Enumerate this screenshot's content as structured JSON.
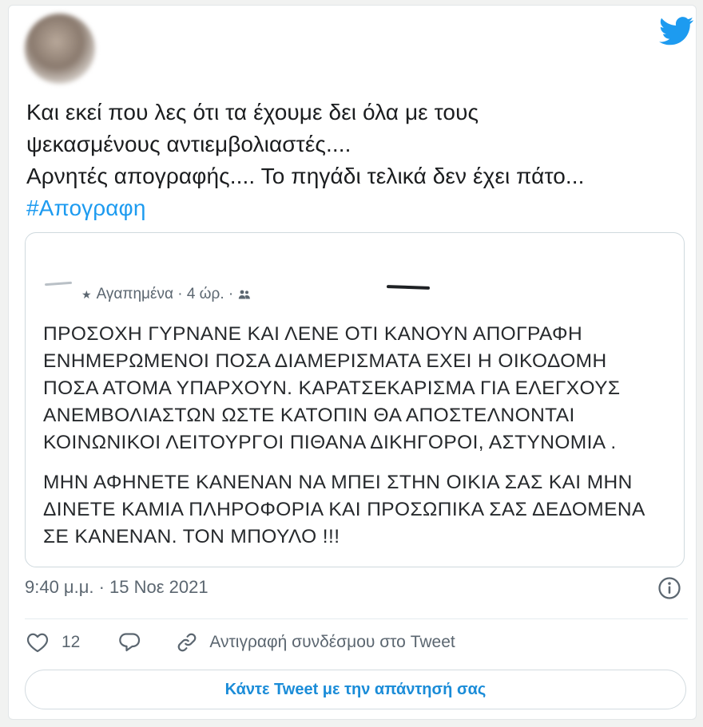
{
  "tweet": {
    "text_lines": [
      "Και εκεί που λες ότι τα έχουμε δει όλα με τους",
      "ψεκασμένους αντιεμβολιαστές....",
      "Αρνητές απογραφής.... Το πηγάδι τελικά δεν έχει πάτο..."
    ],
    "hashtag": "#Απογραφη",
    "timestamp": "9:40 μ.μ. · 15 Νοε 2021"
  },
  "quote": {
    "meta": "Αγαπημένα · 4 ώρ. ·",
    "paragraph1": [
      "ΠΡΟΣΟΧΗ ΓΥΡΝΑΝΕ ΚΑΙ ΛΕΝΕ ΟΤΙ ΚΑΝΟΥΝ ΑΠΟΓΡΑΦΗ",
      "ΕΝΗΜΕΡΩΜΕΝΟΙ ΠΟΣΑ ΔΙΑΜΕΡΙΣΜΑΤΑ ΕΧΕΙ Η ΟΙΚΟΔΟΜΗ",
      "ΠΟΣΑ ΑΤΟΜΑ ΥΠΑΡΧΟΥΝ. ΚΑΡΑΤΣΕΚΑΡΙΣΜΑ ΓΙΑ  ΕΛΕΓΧΟΥΣ",
      "ΑΝΕΜΒΟΛΙΑΣΤΩΝ ΩΣΤΕ ΚΑΤΟΠΙΝ ΘΑ ΑΠΟΣΤΕΛΝΟΝΤΑΙ",
      "ΚΟΙΝΩΝΙΚΟΙ ΛΕΙΤΟΥΡΓΟΙ ΠΙΘΑΝΑ ΔΙΚΗΓΟΡΟΙ, ΑΣΤΥΝΟΜΙΑ ."
    ],
    "paragraph2": [
      "ΜΗΝ ΑΦΗΝΕΤΕ ΚΑΝΕΝΑΝ ΝΑ ΜΠΕΙ ΣΤΗΝ ΟΙΚΙΑ ΣΑΣ ΚΑΙ ΜΗΝ",
      "ΔΙΝΕΤΕ ΚΑΜΙΑ ΠΛΗΡΟΦΟΡΙΑ ΚΑΙ ΠΡΟΣΩΠΙΚΑ ΣΑΣ ΔΕΔΟΜΕΝΑ",
      "ΣΕ ΚΑΝΕΝΑΝ. ΤΟΝ ΜΠΟΥΛΟ !!!"
    ]
  },
  "actions": {
    "like_count": "12",
    "copy_link_label": "Αντιγραφή συνδέσμου στο Tweet"
  },
  "reply_button": "Κάντε Tweet με την απάντησή σας",
  "colors": {
    "accent": "#1d9bf0",
    "reply_text": "#1a8cd8",
    "muted": "#5b6670"
  },
  "icons": [
    "twitter-bird-icon",
    "people-icon",
    "info-icon",
    "heart-icon",
    "reply-bubble-icon",
    "link-icon"
  ]
}
